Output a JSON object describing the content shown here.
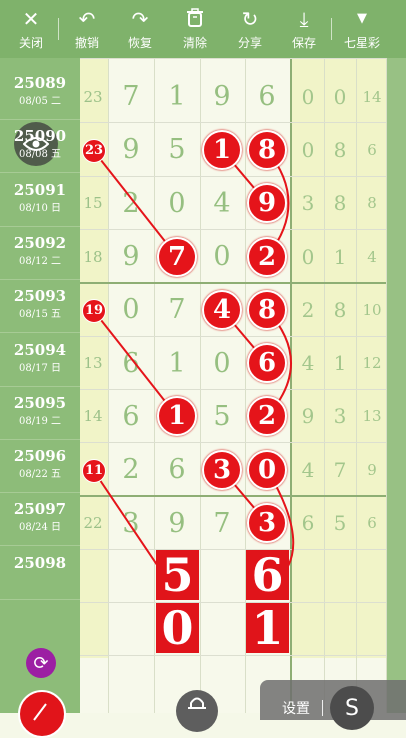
{
  "toolbar": {
    "close_label": "关闭",
    "undo_label": "撤销",
    "redo_label": "恢复",
    "clear_label": "清除",
    "share_label": "分享",
    "save_label": "保存",
    "lottery_label": "七星彩"
  },
  "issues": [
    {
      "no": "25089",
      "date": "08/05 二"
    },
    {
      "no": "25090",
      "date": "08/08 五"
    },
    {
      "no": "25091",
      "date": "08/10 日"
    },
    {
      "no": "25092",
      "date": "08/12 二"
    },
    {
      "no": "25093",
      "date": "08/15 五"
    },
    {
      "no": "25094",
      "date": "08/17 日"
    },
    {
      "no": "25095",
      "date": "08/19 二"
    },
    {
      "no": "25096",
      "date": "08/22 五"
    },
    {
      "no": "25097",
      "date": "08/24 日"
    },
    {
      "no": "25098",
      "date": ""
    }
  ],
  "rows": [
    {
      "side": "23",
      "mid": [
        "7",
        "1",
        "9",
        "6"
      ],
      "right": [
        "0",
        "0",
        "14"
      ]
    },
    {
      "side": "23",
      "mid": [
        "9",
        "5",
        "1",
        "8"
      ],
      "right": [
        "0",
        "8",
        "6"
      ]
    },
    {
      "side": "15",
      "mid": [
        "2",
        "0",
        "4",
        "9"
      ],
      "right": [
        "3",
        "8",
        "8"
      ]
    },
    {
      "side": "18",
      "mid": [
        "9",
        "7",
        "0",
        "2"
      ],
      "right": [
        "0",
        "1",
        "4"
      ]
    },
    {
      "side": "19",
      "mid": [
        "0",
        "7",
        "4",
        "8"
      ],
      "right": [
        "2",
        "8",
        "10"
      ]
    },
    {
      "side": "13",
      "mid": [
        "6",
        "1",
        "0",
        "6"
      ],
      "right": [
        "4",
        "1",
        "12"
      ]
    },
    {
      "side": "14",
      "mid": [
        "6",
        "1",
        "5",
        "2"
      ],
      "right": [
        "9",
        "3",
        "13"
      ]
    },
    {
      "side": "11",
      "mid": [
        "2",
        "6",
        "3",
        "0"
      ],
      "right": [
        "4",
        "7",
        "9"
      ]
    },
    {
      "side": "22",
      "mid": [
        "3",
        "9",
        "7",
        "3"
      ],
      "right": [
        "6",
        "5",
        "6"
      ]
    }
  ],
  "predictions": {
    "col2": [
      "5",
      "0"
    ],
    "col4": [
      "6",
      "1"
    ]
  },
  "settings_label": "设置",
  "s_label": "S",
  "colors": {
    "toolbar": "#7fb26b",
    "ball": "#e5141a",
    "purple": "#9c1fa3"
  }
}
